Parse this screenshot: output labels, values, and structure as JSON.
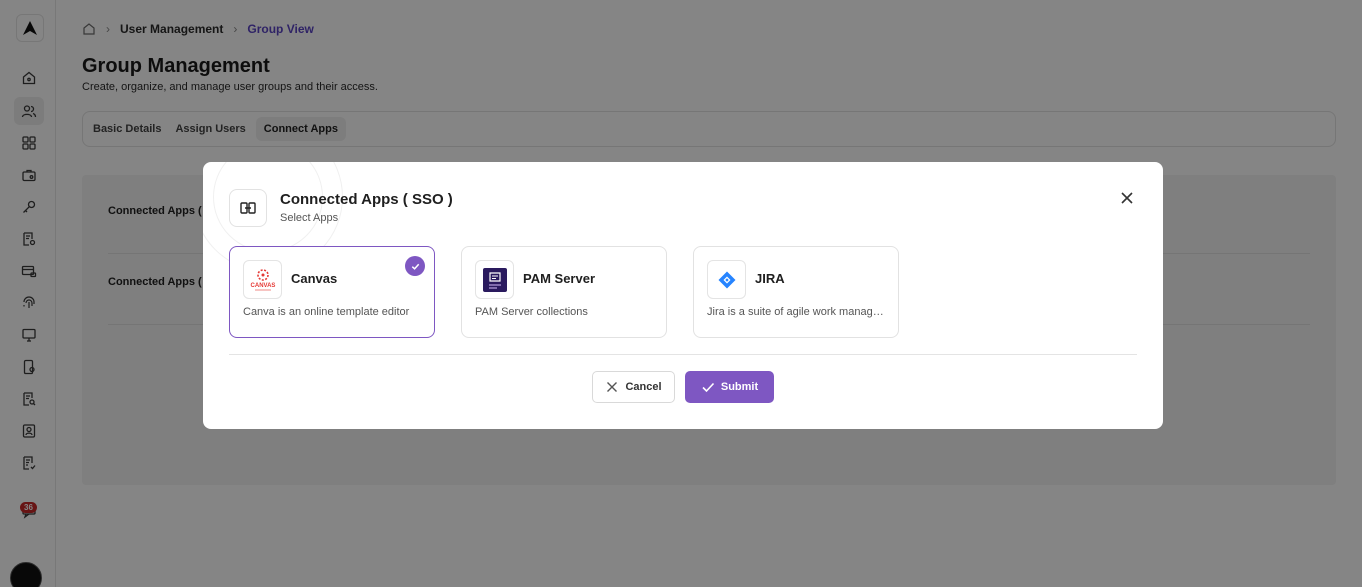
{
  "breadcrumb": {
    "items": [
      "User Management"
    ],
    "current": "Group View"
  },
  "page": {
    "title": "Group Management",
    "subtitle": "Create, organize, and manage user groups and their access."
  },
  "tabs": [
    {
      "label": "Basic Details"
    },
    {
      "label": "Assign Users"
    },
    {
      "label": "Connect Apps",
      "active": true
    }
  ],
  "panel": {
    "rows": [
      "Connected Apps (",
      "Connected Apps ("
    ]
  },
  "sidebar": {
    "icons": [
      "home-icon",
      "users-icon",
      "grid-icon",
      "briefcase-icon",
      "key-icon",
      "document-settings-icon",
      "card-lock-icon",
      "fingerprint-icon",
      "monitor-icon",
      "device-settings-icon",
      "document-search-icon",
      "badge-icon",
      "report-icon",
      "notification-icon"
    ],
    "notification_count": "36"
  },
  "modal": {
    "title": "Connected Apps ( SSO )",
    "subtitle": "Select Apps",
    "apps": [
      {
        "name": "Canvas",
        "description": "Canva is an online template editor",
        "selected": true,
        "logo_text": "CANVAS"
      },
      {
        "name": "PAM Server",
        "description": "PAM Server collections",
        "selected": false
      },
      {
        "name": "JIRA",
        "description": "Jira is a suite of agile work management tools",
        "selected": false
      }
    ],
    "cancel_label": "Cancel",
    "submit_label": "Submit"
  },
  "colors": {
    "accent": "#7e57c2",
    "breadcrumb_current": "#5b44c4",
    "badge": "#c62828",
    "jira_blue": "#2684ff"
  }
}
